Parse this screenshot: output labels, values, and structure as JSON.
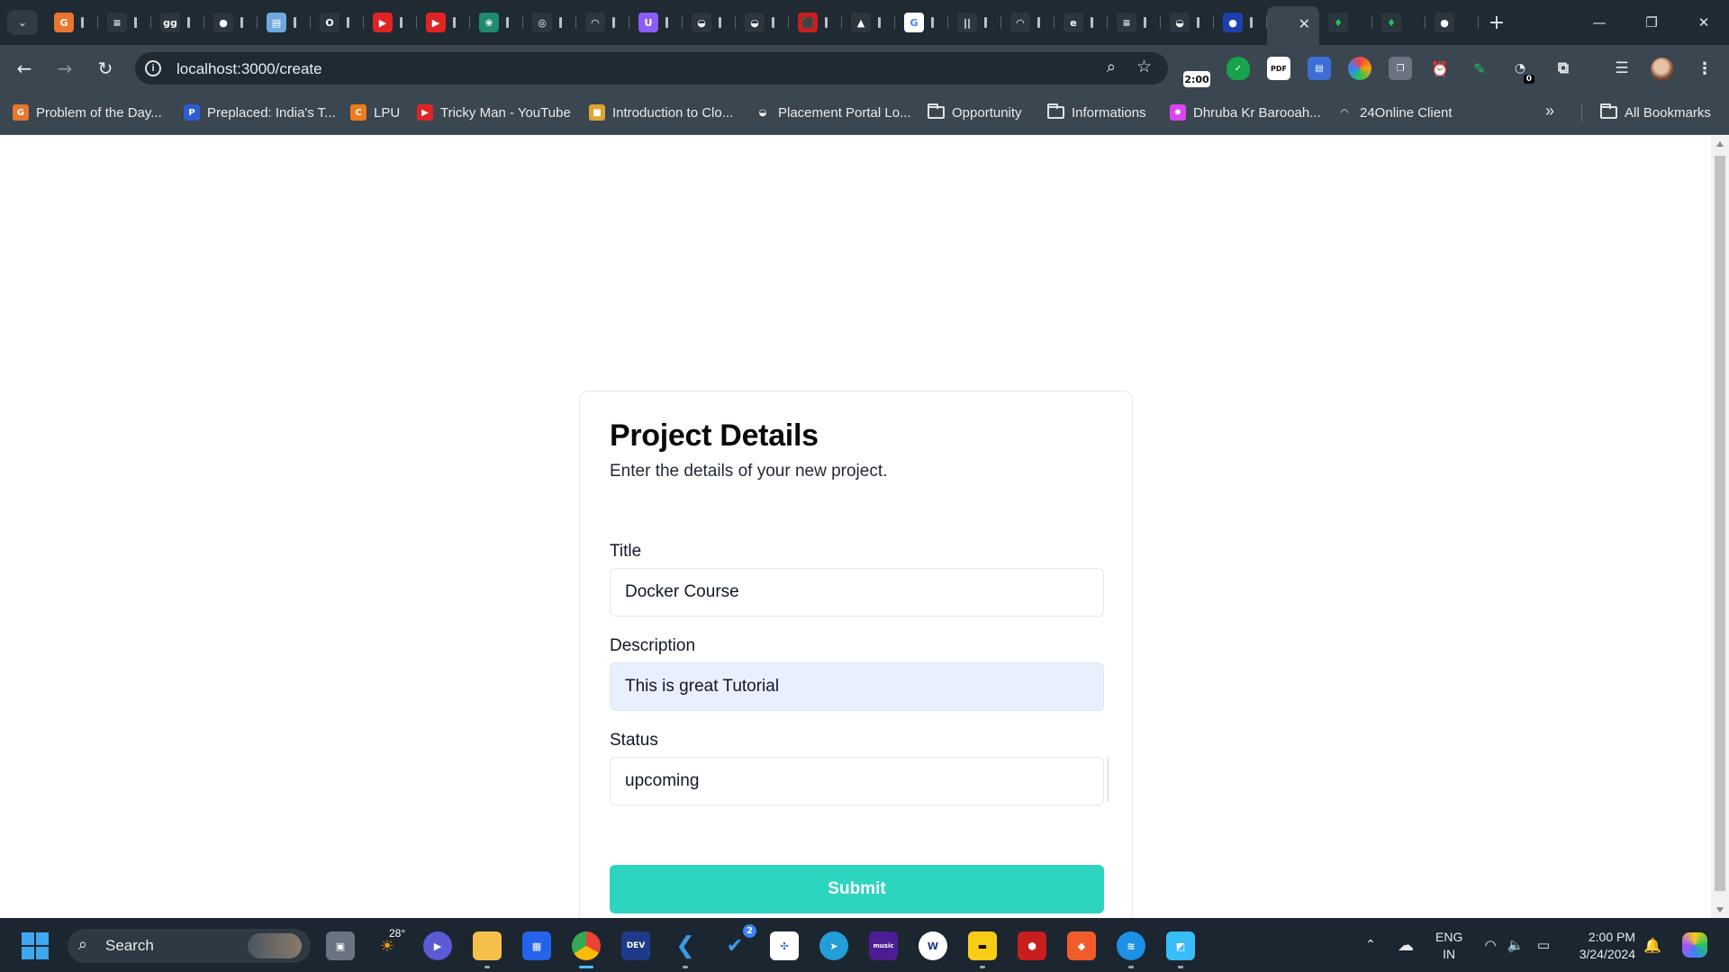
{
  "browser": {
    "tabs": [
      {
        "icon": "gfg-icon",
        "color": "#e8762d",
        "glyph": "G"
      },
      {
        "icon": "codeforces-icon",
        "color": "#2b3640",
        "glyph": "≡"
      },
      {
        "icon": "gfg-green-icon",
        "color": "#2b3640",
        "glyph": "gg"
      },
      {
        "icon": "github-icon",
        "color": "#2b3640",
        "glyph": "●"
      },
      {
        "icon": "doc-icon",
        "color": "#6fa8dc",
        "glyph": "▤"
      },
      {
        "icon": "opera-icon",
        "color": "#2b3640",
        "glyph": "O"
      },
      {
        "icon": "youtube-icon",
        "color": "#e02424",
        "glyph": "▶"
      },
      {
        "icon": "youtube-icon",
        "color": "#e02424",
        "glyph": "▶"
      },
      {
        "icon": "chatgpt-icon",
        "color": "#1f8a70",
        "glyph": "❀"
      },
      {
        "icon": "circle-icon",
        "color": "#2b3640",
        "glyph": "◎"
      },
      {
        "icon": "gauge-icon",
        "color": "#2b3640",
        "glyph": "◠"
      },
      {
        "icon": "u-icon",
        "color": "#8b5cf6",
        "glyph": "U"
      },
      {
        "icon": "globe-icon",
        "color": "#2b3640",
        "glyph": "◒"
      },
      {
        "icon": "globe-icon",
        "color": "#2b3640",
        "glyph": "◒"
      },
      {
        "icon": "pdf-icon",
        "color": "#c81e1e",
        "glyph": "⬛"
      },
      {
        "icon": "drive-icon",
        "color": "#2b3640",
        "glyph": "▲"
      },
      {
        "icon": "google-icon",
        "color": "#ffffff",
        "glyph": "G"
      },
      {
        "icon": "bars-icon",
        "color": "#2b3640",
        "glyph": "||"
      },
      {
        "icon": "cloud-icon",
        "color": "#2b3640",
        "glyph": "◠"
      },
      {
        "icon": "edge-icon",
        "color": "#2b3640",
        "glyph": "e"
      },
      {
        "icon": "codeforces-icon",
        "color": "#2b3640",
        "glyph": "≡"
      },
      {
        "icon": "globe-icon",
        "color": "#2b3640",
        "glyph": "◒"
      },
      {
        "icon": "blue-circle-icon",
        "color": "#1e40af",
        "glyph": "●"
      }
    ],
    "active_tab_close": "✕",
    "after_tabs": [
      {
        "icon": "leaf-icon",
        "color": "#2b3640",
        "glyph": "♦"
      },
      {
        "icon": "leaf-icon",
        "color": "#2b3640",
        "glyph": "♦"
      },
      {
        "icon": "github-icon",
        "color": "#2b3640",
        "glyph": "●"
      }
    ],
    "new_tab": "+",
    "url": "localhost:3000/create",
    "extension_timer": "2:00",
    "extension_badge": "0",
    "bookmarks": [
      {
        "label": "Problem of the Day...",
        "icon": "gfg-icon",
        "color": "#e8762d",
        "glyph": "G"
      },
      {
        "label": "Preplaced: India's T...",
        "icon": "preplaced-icon",
        "color": "#2f5bd3",
        "glyph": "P"
      },
      {
        "label": "LPU",
        "icon": "lpu-icon",
        "color": "#f07b1d",
        "glyph": "C"
      },
      {
        "label": "Tricky Man - YouTube",
        "icon": "youtube-icon",
        "color": "#e02424",
        "glyph": "▶"
      },
      {
        "label": "Introduction to Clo...",
        "icon": "box-icon",
        "color": "#e0a32d",
        "glyph": "■"
      },
      {
        "label": "Placement Portal Lo...",
        "icon": "globe-icon",
        "color": "#3a4650",
        "glyph": "◒"
      },
      {
        "label": "Opportunity",
        "icon": "folder-icon",
        "folder": true
      },
      {
        "label": "Informations",
        "icon": "folder-icon",
        "folder": true
      },
      {
        "label": "Dhruba Kr Barooah...",
        "icon": "pinwheel-icon",
        "color": "#d946ef",
        "glyph": "✸"
      },
      {
        "label": "24Online Client",
        "icon": "cloud-icon",
        "color": "#3a4650",
        "glyph": "◠"
      }
    ],
    "overflow": "»",
    "all_bookmarks": "All Bookmarks"
  },
  "form": {
    "heading": "Project Details",
    "subheading": "Enter the details of your new project.",
    "title_label": "Title",
    "title_value": "Docker Course",
    "description_label": "Description",
    "description_value": "This is great Tutorial",
    "status_label": "Status",
    "status_value": "upcoming",
    "submit_label": "Submit"
  },
  "taskbar": {
    "search_label": "Search",
    "weather_temp": "28°",
    "language_line1": "ENG",
    "language_line2": "IN",
    "time": "2:00 PM",
    "date": "3/24/2024",
    "telegram_badge": "2"
  },
  "colors": {
    "accent_submit": "#2dd4bf",
    "autofill_bg": "#e8f0fe",
    "chrome_dark": "#1f2a33",
    "chrome_toolbar": "#3a4650"
  }
}
